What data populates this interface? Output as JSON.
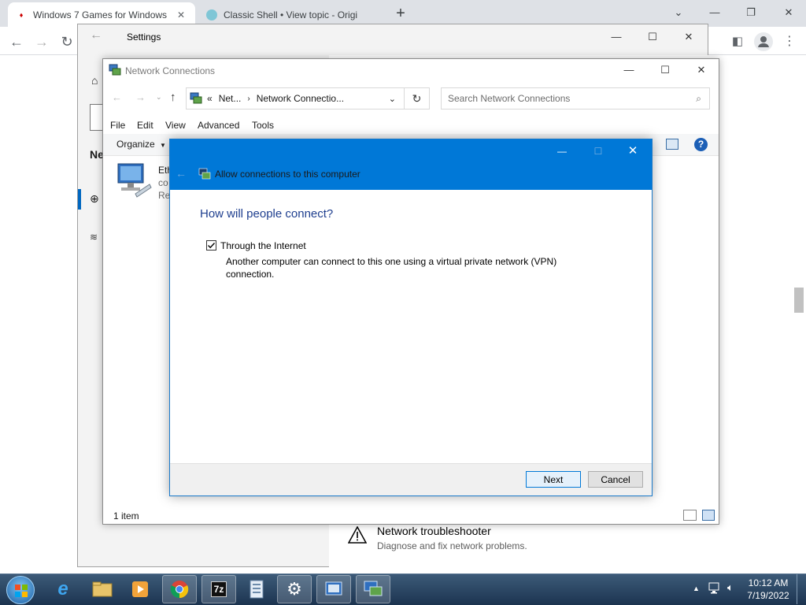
{
  "browser": {
    "tabs": [
      {
        "title": "Windows 7 Games for Windows"
      },
      {
        "title": "Classic Shell • View topic - Origi"
      }
    ],
    "new_tab": "+"
  },
  "settings": {
    "title": "Settings",
    "partial_heading": "Ne",
    "troubleshooter": {
      "title": "Network troubleshooter",
      "desc": "Diagnose and fix network problems."
    }
  },
  "netconn": {
    "title": "Network Connections",
    "address": {
      "chevrons": "«",
      "segment1": "Net...",
      "segment2": "Network Connectio..."
    },
    "search_placeholder": "Search Network Connections",
    "menu": [
      "File",
      "Edit",
      "View",
      "Advanced",
      "Tools"
    ],
    "organize": "Organize",
    "item_label_lines": [
      "Eth",
      "co",
      "Re"
    ],
    "status": "1 item"
  },
  "dialog": {
    "title": "Allow connections to this computer",
    "heading": "How will people connect?",
    "option_label": "Through the Internet",
    "option_desc_line1": "Another computer can connect to this one using a virtual private network (VPN)",
    "option_desc_line2": "connection.",
    "option_checked": true,
    "next_label": "Next",
    "cancel_label": "Cancel"
  },
  "taskbar": {
    "time": "10:12 AM",
    "date": "7/19/2022",
    "zip_label": "7z"
  },
  "colors": {
    "dialog_header": "#0078d7",
    "heading_blue": "#003399",
    "taskbar": "#2a4564"
  }
}
